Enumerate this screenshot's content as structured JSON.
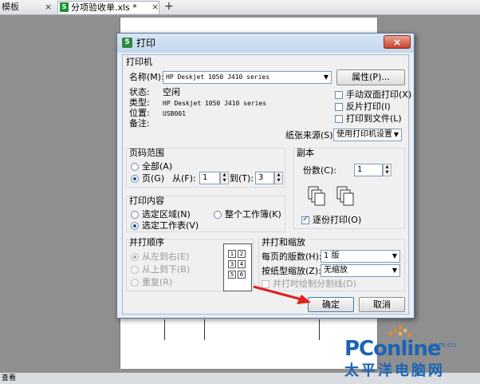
{
  "tabs": {
    "template_tab": "模板",
    "file_tab": "分项验收单.xls *",
    "close_glyph": "×",
    "new_tab_glyph": "+",
    "file_icon_letter": "S"
  },
  "bottom_bar": {
    "label": "查看"
  },
  "dialog": {
    "title": "打印",
    "icon_letter": "5",
    "close_glyph": "×",
    "printer": {
      "group_title": "打印机",
      "name_label": "名称(M):",
      "name_value": "HP Deskjet 1050 J410 series",
      "properties_button": "属性(P)...",
      "status_label": "状态:",
      "status_value": "空闲",
      "type_label": "类型:",
      "type_value": "HP Deskjet 1050 J410 series",
      "location_label": "位置:",
      "location_value": "USB001",
      "comment_label": "备注:",
      "manual_duplex": "手动双面打印(X)",
      "reverse_print": "反片打印(I)",
      "print_to_file": "打印到文件(L)",
      "paper_source_label": "纸张来源(S):",
      "paper_source_value": "使用打印机设置"
    },
    "page_range": {
      "group_title": "页码范围",
      "all": "全部(A)",
      "pages": "页(G)",
      "from_label": "从(F):",
      "from_value": "1",
      "to_label": "到(T):",
      "to_value": "3"
    },
    "copies": {
      "group_title": "副本",
      "count_label": "份数(C):",
      "count_value": "1",
      "collate": "逐份打印(O)"
    },
    "print_what": {
      "group_title": "打印内容",
      "selection": "选定区域(N)",
      "entire_workbook": "整个工作簿(K)",
      "active_sheets": "选定工作表(V)"
    },
    "collate_order": {
      "group_title": "并打顺序",
      "left_to_right": "从左到右(E)",
      "top_to_bottom": "从上到下(B)",
      "repeat": "重复(R)",
      "cells": [
        "1",
        "2",
        "3",
        "4",
        "5",
        "6"
      ]
    },
    "scaling": {
      "group_title": "并打和缩放",
      "pages_per_sheet_label": "每页的版数(H):",
      "pages_per_sheet_value": "1 版",
      "scale_label": "按纸型缩放(Z):",
      "scale_value": "无缩放",
      "draw_borders": "并打时绘制分割线(D)"
    },
    "ok_button": "确定",
    "cancel_button": "取消"
  },
  "watermark": {
    "brand": "PConline",
    "domain_suffix": ".com.cn",
    "chinese_name": "太平洋电脑网"
  },
  "colors": {
    "brand": "#1b64b4",
    "selection_blue": "#1a4f9c",
    "arrow_red": "#e02020"
  }
}
